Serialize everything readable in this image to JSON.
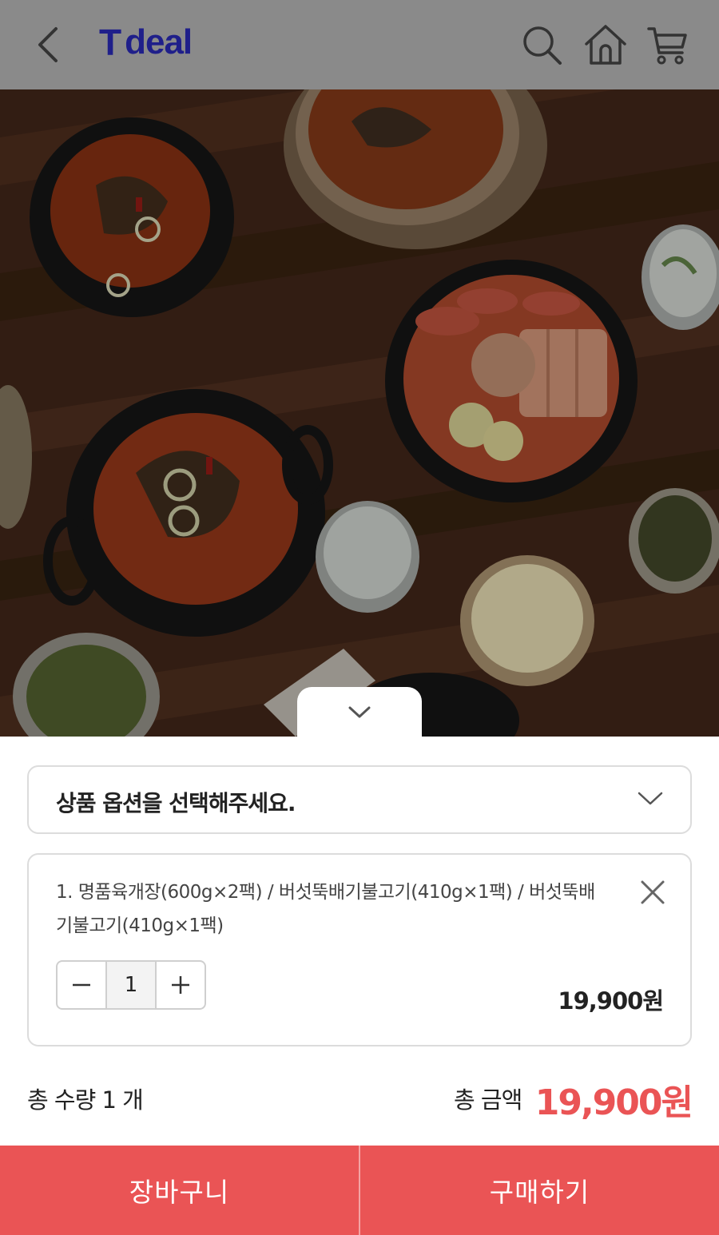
{
  "header": {
    "logo_prefix": "T",
    "logo_word": "deal"
  },
  "icons": {
    "back": "chevron-left-icon",
    "search": "search-icon",
    "home": "home-icon",
    "cart": "cart-icon",
    "collapse": "chevron-down-icon",
    "option_dropdown": "chevron-down-icon",
    "remove": "close-icon",
    "minus": "minus-icon",
    "plus": "plus-icon"
  },
  "option_select": {
    "placeholder": "상품 옵션을 선택해주세요."
  },
  "selected_item": {
    "name": "1. 명품육개장(600g×2팩) / 버섯뚝배기불고기(410g×1팩) / 버섯뚝배기불고기(410g×1팩)",
    "quantity": "1",
    "price": "19,900원"
  },
  "summary": {
    "total_qty": "총 수량 1 개",
    "total_amount_label": "총 금액",
    "total_amount": "19,900원"
  },
  "buttons": {
    "cart": "장바구니",
    "buy": "구매하기"
  },
  "colors": {
    "header_bg": "#8a8a8a",
    "brand": "#1f1f8a",
    "accent": "#ea5455"
  }
}
